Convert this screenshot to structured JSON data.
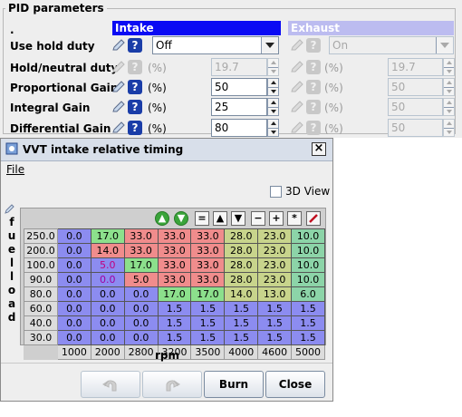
{
  "pid": {
    "title": "PID parameters",
    "dot": ".",
    "intake_header": "Intake",
    "exhaust_header": "Exhaust",
    "rows": [
      {
        "label": "Use hold duty",
        "type": "combo",
        "intake_enabled": true,
        "intake_value": "Off",
        "exhaust_value": "On",
        "unit": ""
      },
      {
        "label": "Hold/neutral duty",
        "type": "spin",
        "intake_enabled": false,
        "intake_value": "19.7",
        "exhaust_value": "19.7",
        "unit": "(%)"
      },
      {
        "label": "Proportional Gain",
        "type": "spin",
        "intake_enabled": true,
        "intake_value": "50",
        "exhaust_value": "50",
        "unit": "(%)"
      },
      {
        "label": "Integral Gain",
        "type": "spin",
        "intake_enabled": true,
        "intake_value": "25",
        "exhaust_value": "50",
        "unit": "(%)"
      },
      {
        "label": "Differential Gain",
        "type": "spin",
        "intake_enabled": true,
        "intake_value": "80",
        "exhaust_value": "50",
        "unit": "(%)"
      }
    ],
    "help_glyph": "?"
  },
  "dialog": {
    "title": "VVT intake relative timing",
    "close_glyph": "×",
    "menu_file": "File",
    "view3d_label": "3D View",
    "y_axis_label": "fuel load",
    "x_axis_label": "rpm",
    "toolbar": [
      "=",
      "▲",
      "▼",
      "−",
      "+",
      "*",
      "/"
    ],
    "rows": [
      "250.0",
      "200.0",
      "100.0",
      "90.0",
      "80.0",
      "60.0",
      "40.0",
      "30.0"
    ],
    "cols": [
      "1000",
      "2000",
      "2800",
      "3200",
      "3500",
      "4000",
      "4600",
      "5000"
    ],
    "cells": [
      [
        "0.0",
        "17.0",
        "33.0",
        "33.0",
        "33.0",
        "28.0",
        "23.0",
        "10.0"
      ],
      [
        "0.0",
        "14.0",
        "33.0",
        "33.0",
        "33.0",
        "28.0",
        "23.0",
        "10.0"
      ],
      [
        "0.0",
        "5.0",
        "17.0",
        "33.0",
        "33.0",
        "28.0",
        "23.0",
        "10.0"
      ],
      [
        "0.0",
        "0.0",
        "5.0",
        "33.0",
        "33.0",
        "28.0",
        "23.0",
        "10.0"
      ],
      [
        "0.0",
        "0.0",
        "0.0",
        "17.0",
        "17.0",
        "14.0",
        "13.0",
        "6.0"
      ],
      [
        "0.0",
        "0.0",
        "0.0",
        "1.5",
        "1.5",
        "1.5",
        "1.5",
        "1.5"
      ],
      [
        "0.0",
        "0.0",
        "0.0",
        "1.5",
        "1.5",
        "1.5",
        "1.5",
        "1.5"
      ],
      [
        "0.0",
        "0.0",
        "0.0",
        "1.5",
        "1.5",
        "1.5",
        "1.5",
        "1.5"
      ]
    ],
    "buttons": {
      "burn": "Burn",
      "close": "Close"
    },
    "colors": {
      "low": "#8c8cf0",
      "green": "#8ce08c",
      "olive": "#c8d48c",
      "red": "#f08c8c",
      "teal": "#8cd4a8"
    }
  }
}
